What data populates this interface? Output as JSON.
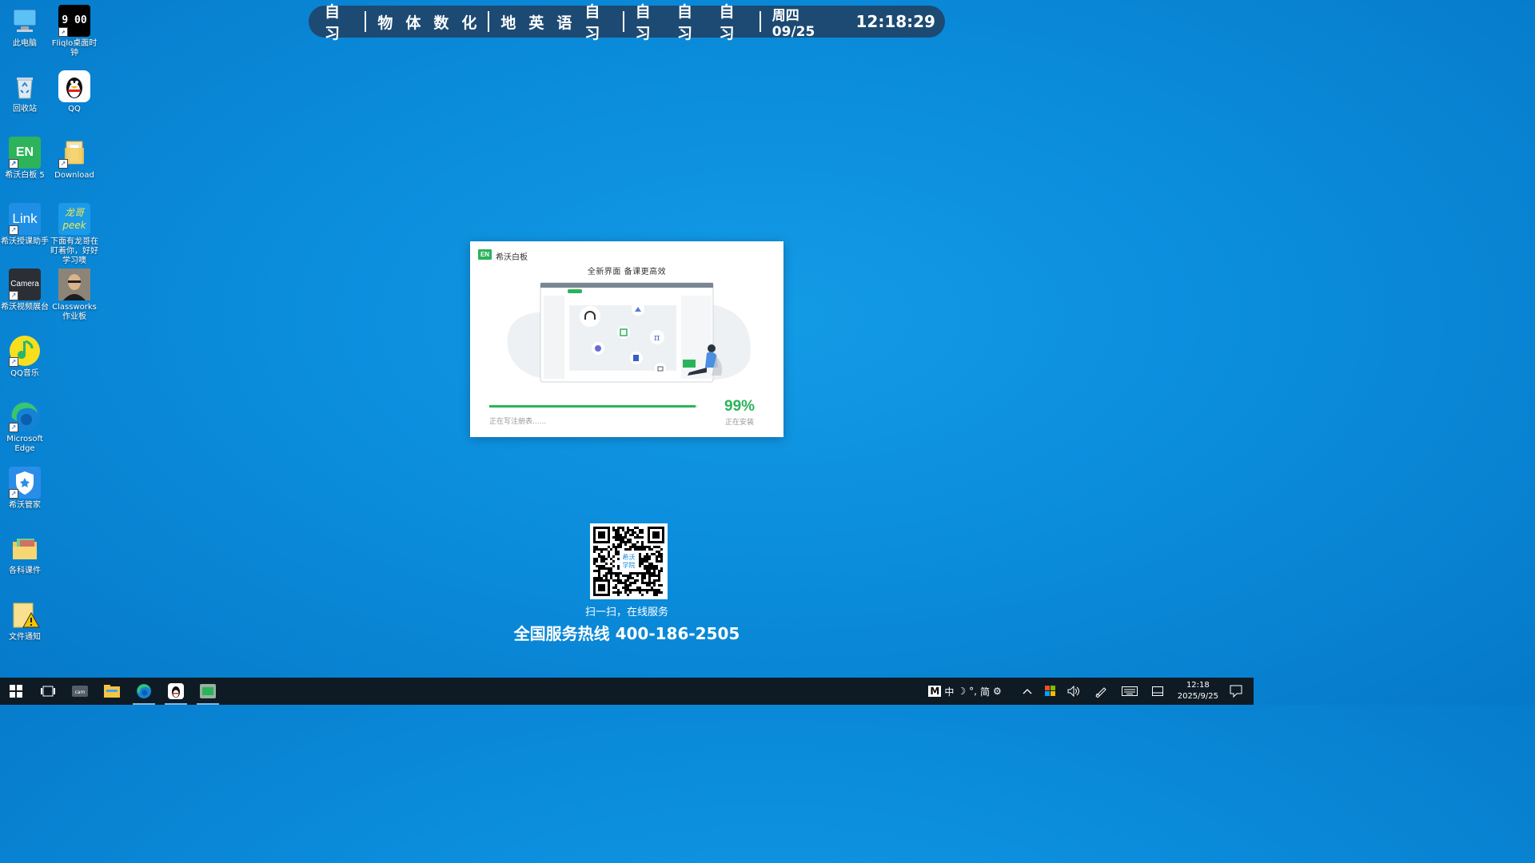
{
  "desktop_icons": [
    {
      "label": "此电脑",
      "icon": "computer-icon"
    },
    {
      "label": "Fliqlo桌面时钟",
      "icon": "flip-clock-icon",
      "clock_text": "9 00"
    },
    {
      "label": "回收站",
      "icon": "recycle-bin-icon"
    },
    {
      "label": "QQ",
      "icon": "qq-penguin-icon"
    },
    {
      "label": "希沃白板 5",
      "icon": "easinote-icon",
      "badge_text": "EN"
    },
    {
      "label": "Download",
      "icon": "folder-icon"
    },
    {
      "label": "希沃授课助手",
      "icon": "seewo-link-icon",
      "badge_text": "Link"
    },
    {
      "label": "下面有龙哥在盯着你，好好学习噢",
      "icon": "peek-image-icon",
      "badge_text": "龙哥 peek"
    },
    {
      "label": "希沃视频展台",
      "icon": "camera-icon",
      "badge_text": "Camera"
    },
    {
      "label": "Classworks作业板",
      "icon": "portrait-icon"
    },
    {
      "label": "QQ音乐",
      "icon": "qq-music-icon"
    },
    {
      "label": "Microsoft Edge",
      "icon": "edge-icon"
    },
    {
      "label": "希沃管家",
      "icon": "seewo-shield-icon"
    },
    {
      "label": "各科课件",
      "icon": "courseware-folder-icon"
    },
    {
      "label": "文件通知",
      "icon": "warning-file-icon"
    }
  ],
  "schedule": {
    "groups": [
      [
        "自习"
      ],
      [
        "物",
        "体",
        "数",
        "化"
      ],
      [
        "地",
        "英",
        "语",
        "自习"
      ],
      [
        "自习",
        "自习",
        "自习"
      ]
    ],
    "date": "周四 09/25",
    "time": "12:18:29"
  },
  "installer": {
    "app_name": "希沃白板",
    "logo_text": "EN",
    "headline": "全新界面  备课更高效",
    "progress": 0.99,
    "percent_text": "99%",
    "status_text": "正在写注册表......",
    "sub_status": "正在安装"
  },
  "qr": {
    "center_label": "希沃学院",
    "caption": "扫一扫，在线服务",
    "hotline": "全国服务热线 400-186-2505"
  },
  "taskbar": {
    "apps": [
      {
        "name": "start",
        "icon": "windows-start-icon"
      },
      {
        "name": "task-view",
        "icon": "task-view-icon"
      },
      {
        "name": "camera-app",
        "icon": "camera-app-icon"
      },
      {
        "name": "file-explorer",
        "icon": "folder-icon"
      },
      {
        "name": "edge",
        "icon": "edge-icon",
        "active": true
      },
      {
        "name": "qq",
        "icon": "qq-penguin-icon",
        "active": true
      },
      {
        "name": "easinote-installer",
        "icon": "easinote-icon",
        "active": true
      }
    ],
    "ime": [
      "M",
      "中",
      "☽",
      "°,",
      "简",
      "⚙"
    ],
    "clock_time": "12:18",
    "clock_date": "2025/9/25"
  }
}
